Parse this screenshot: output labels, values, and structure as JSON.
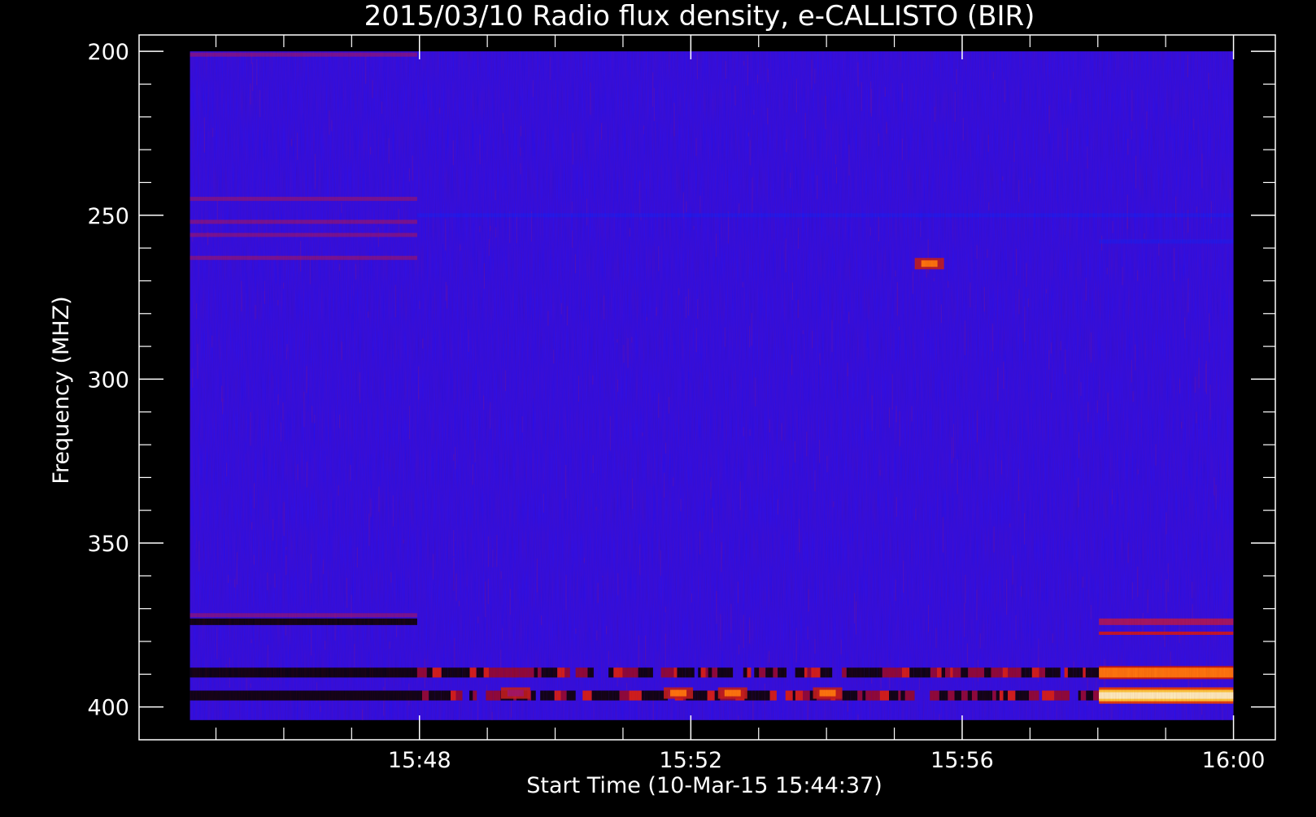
{
  "chart_data": {
    "type": "heatmap",
    "title": "2015/03/10  Radio flux density, e-CALLISTO (BIR)",
    "xlabel": "Start Time (10-Mar-15 15:44:37)",
    "ylabel": "Frequency (MHZ)",
    "x_tick_labels": [
      "15:48",
      "15:52",
      "15:56",
      "16:00"
    ],
    "x_tick_minutes": [
      3.3833,
      7.3833,
      11.3833,
      15.3833
    ],
    "y_tick_values": [
      200,
      250,
      300,
      350,
      400
    ],
    "y_tick_labels": [
      "200",
      "250",
      "300",
      "350",
      "400"
    ],
    "xlim_minutes_from_start": [
      -0.75,
      16.0
    ],
    "ylim_mhz": [
      195,
      410
    ],
    "data_extent": {
      "time_start_minutes": 0,
      "time_end_minutes": 15.3833,
      "freq_min_mhz": 200,
      "freq_max_mhz": 404
    },
    "colormap": {
      "name": "blue-red-yellow-white",
      "background_value": "#2a10ec",
      "low": "#000000",
      "high": "#fffdf0"
    },
    "background_noise_mhz_rows": [
      {
        "freq_mhz": 201,
        "t0_min": 0.0,
        "t1_min": 3.35,
        "level": "red"
      },
      {
        "freq_mhz": 245,
        "t0_min": 0.0,
        "t1_min": 3.35,
        "level": "red"
      },
      {
        "freq_mhz": 252,
        "t0_min": 0.0,
        "t1_min": 3.35,
        "level": "red"
      },
      {
        "freq_mhz": 256,
        "t0_min": 0.0,
        "t1_min": 3.35,
        "level": "red"
      },
      {
        "freq_mhz": 263,
        "t0_min": 0.0,
        "t1_min": 3.35,
        "level": "red"
      },
      {
        "freq_mhz": 250,
        "t0_min": 3.35,
        "t1_min": 15.38,
        "level": "blue"
      },
      {
        "freq_mhz": 258,
        "t0_min": 13.4,
        "t1_min": 15.38,
        "level": "blue"
      },
      {
        "freq_mhz": 372,
        "t0_min": 0.0,
        "t1_min": 3.35,
        "level": "red"
      }
    ],
    "bands": [
      {
        "freq_mhz_from": 373,
        "freq_mhz_to": 375,
        "t0_min": 0.0,
        "t1_min": 3.35,
        "level": "dark"
      },
      {
        "freq_mhz_from": 388,
        "freq_mhz_to": 391,
        "t0_min": 0.0,
        "t1_min": 3.35,
        "level": "dark"
      },
      {
        "freq_mhz_from": 395,
        "freq_mhz_to": 398,
        "t0_min": 0.0,
        "t1_min": 3.35,
        "level": "dark"
      },
      {
        "freq_mhz_from": 388,
        "freq_mhz_to": 391,
        "t0_min": 3.35,
        "t1_min": 13.4,
        "level": "mixed"
      },
      {
        "freq_mhz_from": 395,
        "freq_mhz_to": 398,
        "t0_min": 3.35,
        "t1_min": 13.4,
        "level": "mixed"
      },
      {
        "freq_mhz_from": 373,
        "freq_mhz_to": 375,
        "t0_min": 13.4,
        "t1_min": 15.38,
        "level": "red"
      },
      {
        "freq_mhz_from": 377,
        "freq_mhz_to": 378,
        "t0_min": 13.4,
        "t1_min": 15.38,
        "level": "dimred"
      },
      {
        "freq_mhz_from": 388,
        "freq_mhz_to": 391,
        "t0_min": 13.4,
        "t1_min": 15.38,
        "level": "orange"
      },
      {
        "freq_mhz_from": 395,
        "freq_mhz_to": 398,
        "t0_min": 13.4,
        "t1_min": 15.38,
        "level": "white"
      }
    ],
    "hot_spots": [
      {
        "t_min": 7.2,
        "freq_mhz": 396,
        "level": "orange"
      },
      {
        "t_min": 8.0,
        "freq_mhz": 396,
        "level": "orange"
      },
      {
        "t_min": 9.4,
        "freq_mhz": 396,
        "level": "orange"
      },
      {
        "t_min": 4.8,
        "freq_mhz": 396,
        "level": "red"
      },
      {
        "t_min": 10.9,
        "freq_mhz": 265,
        "level": "orange"
      }
    ]
  }
}
